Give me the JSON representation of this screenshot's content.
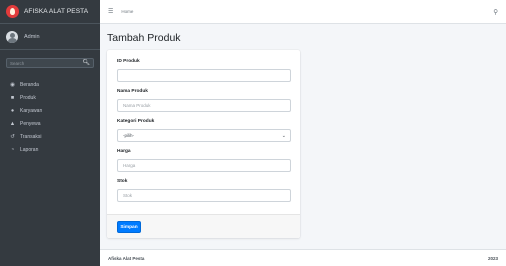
{
  "brand": {
    "name": "AFISKA ALAT PESTA"
  },
  "user": {
    "name": "Admin"
  },
  "sidebar": {
    "search_placeholder": "Search",
    "items": [
      {
        "label": "Beranda",
        "icon": "tachometer-icon"
      },
      {
        "label": "Produk",
        "icon": "file-icon"
      },
      {
        "label": "Karyawan",
        "icon": "user-circle-icon"
      },
      {
        "label": "Penyewa",
        "icon": "user-icon"
      },
      {
        "label": "Transaksi",
        "icon": "history-icon"
      },
      {
        "label": "Laporan",
        "icon": "pie-chart-icon"
      }
    ]
  },
  "header": {
    "home": "Home"
  },
  "page": {
    "title": "Tambah Produk"
  },
  "form": {
    "id_label": "ID Produk",
    "id_value": "",
    "nama_label": "Nama Produk",
    "nama_placeholder": "Nama Produk",
    "kategori_label": "Kategori Produk",
    "kategori_selected": "-pilih-",
    "harga_label": "Harga",
    "harga_placeholder": "Harga",
    "stok_label": "Stok",
    "stok_placeholder": "Stok",
    "submit_label": "Simpan"
  },
  "footer": {
    "brand": "Afiska Alat Pesta",
    "year": "2023"
  },
  "colors": {
    "sidebar": "#343a40",
    "primary": "#007bff",
    "brand_logo": "#e23b3b",
    "background": "#f4f6f9"
  }
}
